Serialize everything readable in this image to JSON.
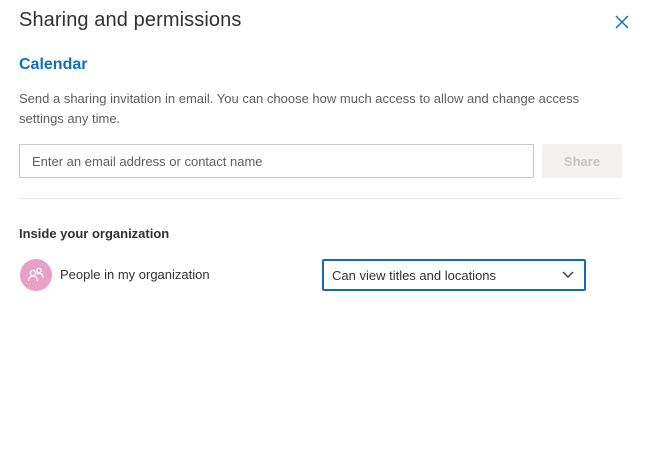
{
  "dialog": {
    "title": "Sharing and permissions",
    "close_icon": "close-icon"
  },
  "calendar": {
    "name": "Calendar",
    "description": "Send a sharing invitation in email. You can choose how much access to allow and change access settings any time."
  },
  "invite": {
    "placeholder": "Enter an email address or contact name",
    "value": "",
    "share_label": "Share"
  },
  "organization": {
    "heading": "Inside your organization",
    "group_label": "People in my organization",
    "avatar_icon": "people-group-icon",
    "permission_selected": "Can view titles and locations",
    "dropdown_icon": "chevron-down-icon"
  },
  "colors": {
    "accent": "#0f6cbd",
    "section_title": "#106ebe",
    "avatar_bg": "#e8a0c8",
    "share_disabled_bg": "#f3f2f1",
    "share_disabled_text": "#c8c6c4"
  }
}
